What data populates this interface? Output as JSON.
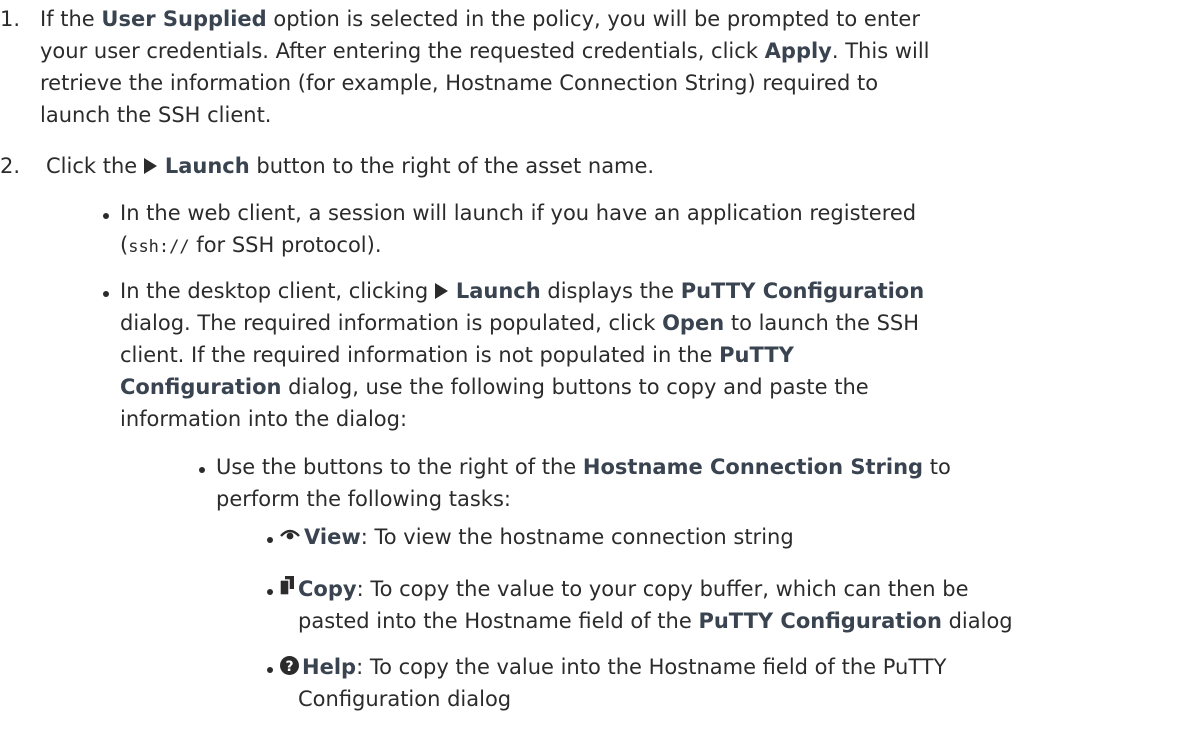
{
  "steps": [
    {
      "number": "1.",
      "lines": {
        "l1_a": "If the ",
        "l1_b": "User Supplied",
        "l1_c": " option is selected in the policy, you will be prompted to enter",
        "l2_a": "your user credentials. After entering the requested credentials, click ",
        "l2_b": "Apply",
        "l2_c": ". This will",
        "l3": "retrieve the information (for example, Hostname Connection String) required to",
        "l4": "launch the SSH client."
      }
    },
    {
      "number": "2.",
      "lines": {
        "a": "Click the ",
        "b": "Launch",
        "c": " button to the right of the asset name."
      }
    }
  ],
  "bullets": {
    "web": {
      "l1": "In the web client, a session will launch if you have an application registered",
      "l2_a": "(",
      "l2_code": "ssh://",
      "l2_b": " for SSH protocol)."
    },
    "desktop": {
      "l1_a": "In the desktop client, clicking ",
      "l1_b": "Launch",
      "l1_c": " displays the ",
      "l1_d": "PuTTY Configuration",
      "l2_a": "dialog. The required information is populated, click ",
      "l2_b": "Open",
      "l2_c": " to launch the SSH",
      "l3_a": "client. If the required information is not populated in the ",
      "l3_b": "PuTTY",
      "l4_a": "Configuration",
      "l4_b": " dialog, use the following buttons to copy and paste the",
      "l5": "information into the dialog:"
    },
    "buttons_intro": {
      "l1_a": "Use the buttons to the right of the ",
      "l1_b": "Hostname Connection String",
      "l1_c": " to",
      "l2": "perform the following tasks:"
    },
    "view": {
      "label": "View",
      "text": ": To view the hostname connection string"
    },
    "copy": {
      "label": "Copy",
      "l1": ": To copy the value to your copy buffer, which can then be",
      "l2_a": "pasted into the Hostname field of the ",
      "l2_b": "PuTTY Configuration",
      "l2_c": " dialog"
    },
    "help": {
      "label": "Help",
      "l1": ": To copy the value into the Hostname field of the PuTTY",
      "l2": "Configuration dialog"
    }
  },
  "icons": [
    "play-icon",
    "eye-icon",
    "copy-icon",
    "help-icon"
  ],
  "colors": {
    "text": "#2b2b2b",
    "bold": "#3a4450"
  }
}
